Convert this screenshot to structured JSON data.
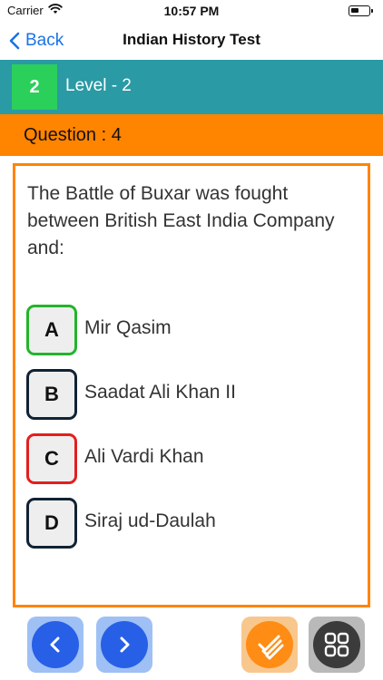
{
  "status_bar": {
    "carrier": "Carrier",
    "time": "10:57 PM"
  },
  "nav": {
    "back_label": "Back",
    "title": "Indian History Test"
  },
  "level": {
    "number": "2",
    "label": "Level - 2",
    "bar_color": "#2a9aa5",
    "badge_color": "#2ad05a"
  },
  "question": {
    "header": "Question : 4",
    "text": "The Battle of Buxar was fought between British East India Company and:",
    "accent_color": "#ff8400"
  },
  "options": [
    {
      "letter": "A",
      "text": "Mir Qasim",
      "state": "correct"
    },
    {
      "letter": "B",
      "text": "Saadat Ali Khan II",
      "state": "default"
    },
    {
      "letter": "C",
      "text": "Ali Vardi Khan",
      "state": "wrong"
    },
    {
      "letter": "D",
      "text": "Siraj ud-Daulah",
      "state": "default"
    }
  ],
  "toolbar": {
    "icons": [
      "chevron-left-icon",
      "chevron-right-icon",
      "check-list-icon",
      "grid-icon"
    ]
  }
}
